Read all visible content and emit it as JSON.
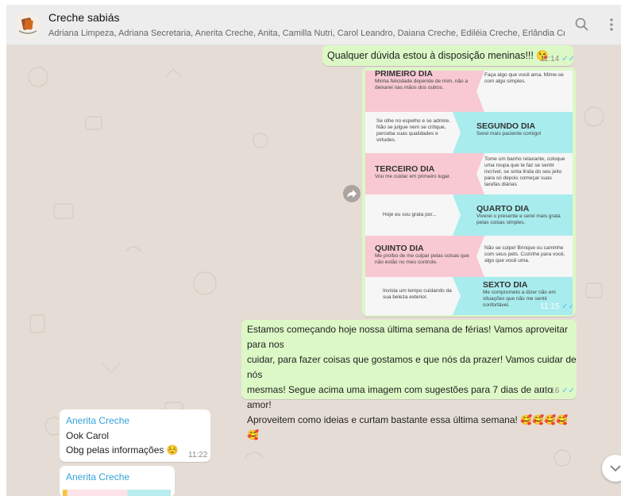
{
  "header": {
    "title": "Creche sabiás",
    "subtitle": "Adriana Limpeza, Adriana Secretaria, Anerita Creche, Anita, Camilla Nutri, Carol Leandro, Daiana Creche, Ediléia Creche, Erlândia Creche, ..."
  },
  "messages": {
    "m1": {
      "text": "Qualquer dúvida estou à disposição meninas!!! 😘",
      "time": "11:14"
    },
    "image": {
      "time": "11:15",
      "rows": [
        {
          "left_title": "PRIMEIRO DIA",
          "left_text": "Minha felicidade depende de mim, não a deixarei nas mãos dos outros.",
          "right_text": "Faça algo que você ama. Mime-se com algo simples."
        },
        {
          "left_text": "Se olhe no espelho e se admire. Não se julgue nem se critique, perceba suas qualidades e virtudes.",
          "right_title": "SEGUNDO DIA",
          "right_text": "Serei mais paciente comigo!"
        },
        {
          "left_title": "TERCEIRO DIA",
          "left_text": "Vou me cuidar em primeiro lugar.",
          "right_text": "Tome um banho relaxante, coloque uma roupa que te faz se sentir incrível, se sinta linda do seu jeito para só depois começar suas tarefas diárias"
        },
        {
          "left_text": "Hoje eu sou grata por...",
          "right_title": "QUARTO DIA",
          "right_text": "Viverei o presente e serei mais grata pelas coisas simples."
        },
        {
          "left_title": "QUINTO DIA",
          "left_text": "Me proíbo de me culpar pelas coisas que não estão no meu controle.",
          "right_text": "Não se culpe! Brinque ou caminhe com seus pets. Cozinhe para você, algo que você uma."
        },
        {
          "left_text": "Invista um tempo cuidando da sua beleza exterior.",
          "right_title": "SEXTO DIA",
          "right_text": "Me comprometo a dizer não em situações que não me sentir confortável."
        }
      ]
    },
    "m2": {
      "lines": [
        "Estamos começando hoje nossa última semana de férias! Vamos aproveitar para nos",
        "cuidar, para fazer coisas que gostamos e que nós da prazer! Vamos cuidar de nós",
        "mesmas! Segue acima uma imagem com sugestões para 7 dias de auto amor!",
        "Aproveitem como ideias e curtam bastante essa última semana! 🥰🥰🥰🥰🥰"
      ],
      "time": "11:16"
    },
    "m3": {
      "sender": "Anerita Creche",
      "line1": "Ook Carol",
      "line2": "Obg pelas informações ☺️",
      "time": "11:22"
    },
    "m4": {
      "sender": "Anerita Creche"
    }
  },
  "colors": {
    "header_bg": "#ededed",
    "chat_bg": "#e5ddd5",
    "outgoing": "#dcf8c6",
    "incoming": "#ffffff",
    "sender": "#35a2d8",
    "tick": "#4fc3f7",
    "pink": "#f8c9d3",
    "cyan": "#a9ecee"
  },
  "icons": {
    "search": "search-icon",
    "menu": "menu-icon",
    "forward": "forward-icon",
    "scroll": "chevron-down-icon"
  }
}
